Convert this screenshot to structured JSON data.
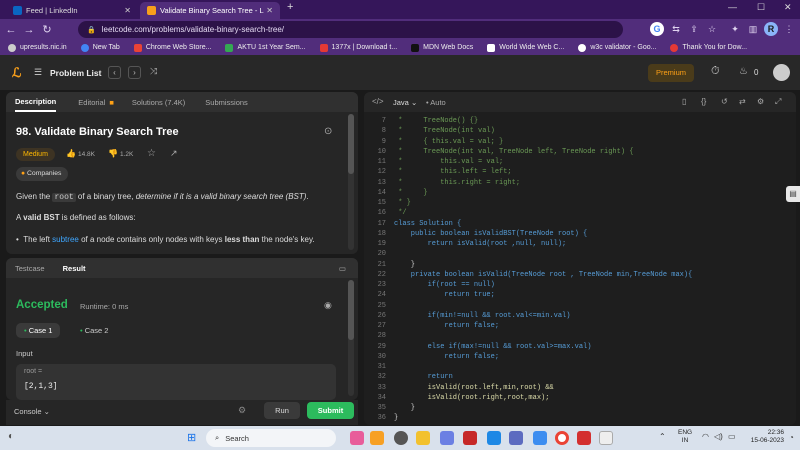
{
  "browser": {
    "tabs": [
      {
        "title": "Feed | LinkedIn"
      },
      {
        "title": "Validate Binary Search Tree - Lee"
      }
    ],
    "new_tab": "+",
    "url": "leetcode.com/problems/validate-binary-search-tree/",
    "profile_initial": "R",
    "bookmarks": [
      "upresults.nic.in",
      "New Tab",
      "Chrome Web Store...",
      "AKTU 1st Year Sem...",
      "1377x | Download t...",
      "MDN Web Docs",
      "World Wide Web C...",
      "w3c validator - Goo...",
      "Thank You for Dow..."
    ]
  },
  "leetcode": {
    "problem_list": "Problem List",
    "premium": "Premium",
    "streak": "0",
    "desc_tabs": [
      "Description",
      "Editorial",
      "Solutions (7.4K)",
      "Submissions"
    ],
    "title": "98. Validate Binary Search Tree",
    "difficulty": "Medium",
    "likes": "14.8K",
    "dislikes": "1.2K",
    "companies": "Companies",
    "desc_p1_a": "Given the ",
    "desc_p1_code": "root",
    "desc_p1_b": " of a binary tree, ",
    "desc_p1_em": "determine if it is a valid binary search tree (BST)",
    "desc_p1_c": ".",
    "desc_p2_a": "A ",
    "desc_p2_b": "valid BST",
    "desc_p2_c": " is defined as follows:",
    "bullet_a": "The left ",
    "bullet_link": "subtree",
    "bullet_b": " of a node contains only nodes with keys ",
    "bullet_c": "less than",
    "bullet_d": " the node's key.",
    "result_tabs": [
      "Testcase",
      "Result"
    ],
    "accepted": "Accepted",
    "runtime": "Runtime: 0 ms",
    "cases": [
      "Case 1",
      "Case 2"
    ],
    "input_label": "Input",
    "var_name": "root =",
    "var_value": "[2,1,3]",
    "console": "Console",
    "run": "Run",
    "submit": "Submit",
    "lang": "Java",
    "auto": "Auto"
  },
  "code_lines": [
    {
      "n": "7",
      "t": " *     TreeNode() {}"
    },
    {
      "n": "8",
      "t": " *     TreeNode(int val)"
    },
    {
      "n": "9",
      "t": " *     { this.val = val; }"
    },
    {
      "n": "10",
      "t": " *     TreeNode(int val, TreeNode left, TreeNode right) {"
    },
    {
      "n": "11",
      "t": " *         this.val = val;"
    },
    {
      "n": "12",
      "t": " *         this.left = left;"
    },
    {
      "n": "13",
      "t": " *         this.right = right;"
    },
    {
      "n": "14",
      "t": " *     }"
    },
    {
      "n": "15",
      "t": " * }"
    },
    {
      "n": "16",
      "t": " */"
    },
    {
      "n": "17",
      "t": "class Solution {"
    },
    {
      "n": "18",
      "t": "    public boolean isValidBST(TreeNode root) {"
    },
    {
      "n": "19",
      "t": "        return isValid(root ,null, null);"
    },
    {
      "n": "20",
      "t": ""
    },
    {
      "n": "21",
      "t": "    }"
    },
    {
      "n": "22",
      "t": "    private boolean isValid(TreeNode root , TreeNode min,TreeNode max){"
    },
    {
      "n": "23",
      "t": "        if(root == null)"
    },
    {
      "n": "24",
      "t": "            return true;"
    },
    {
      "n": "25",
      "t": ""
    },
    {
      "n": "26",
      "t": "        if(min!=null && root.val<=min.val)"
    },
    {
      "n": "27",
      "t": "            return false;"
    },
    {
      "n": "28",
      "t": ""
    },
    {
      "n": "29",
      "t": "        else if(max!=null && root.val>=max.val)"
    },
    {
      "n": "30",
      "t": "            return false;"
    },
    {
      "n": "31",
      "t": ""
    },
    {
      "n": "32",
      "t": "        return"
    },
    {
      "n": "33",
      "t": "        isValid(root.left,min,root) &&"
    },
    {
      "n": "34",
      "t": "        isValid(root.right,root,max);"
    },
    {
      "n": "35",
      "t": "    }"
    },
    {
      "n": "36",
      "t": "}"
    }
  ],
  "taskbar": {
    "search": "Search",
    "lang1": "ENG",
    "lang2": "IN",
    "time": "22:36",
    "date": "15-06-2023"
  },
  "colors": {
    "accent_green": "#2cbb5d",
    "medium": "#ffb800",
    "comment": "#6a9955",
    "keyword": "#569cd6",
    "method": "#dcdcaa"
  }
}
